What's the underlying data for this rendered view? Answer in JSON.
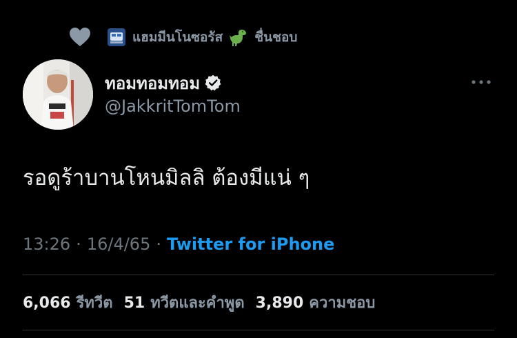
{
  "social_context": {
    "icon": "heart-icon",
    "badge_icon": "train-emoji-icon",
    "liked_by": "แฮมมีนโนซอรัส",
    "dino_icon": "dinosaur-emoji-icon",
    "action": "ชื่นชอบ"
  },
  "author": {
    "name": "ทอมทอมทอม",
    "verified_icon": "verified-badge-icon",
    "handle": "@JakkritTomTom",
    "avatar_icon": "avatar"
  },
  "tweet": {
    "text": "รอดูร้าบานโหนมิลลิ ต้องมีแน่ ๆ",
    "time": "13:26",
    "separator": "·",
    "date": "16/4/65",
    "source": "Twitter for iPhone"
  },
  "stats": {
    "retweets_count": "6,066",
    "retweets_label": "รีทวีต",
    "quotes_count": "51",
    "quotes_label": "ทวีตและคำพูด",
    "likes_count": "3,890",
    "likes_label": "ความชอบ"
  },
  "colors": {
    "background": "#000000",
    "primary_text": "#e7e9ea",
    "secondary_text": "#8b98a5",
    "link": "#1d9bf0",
    "divider": "#2f3336"
  }
}
